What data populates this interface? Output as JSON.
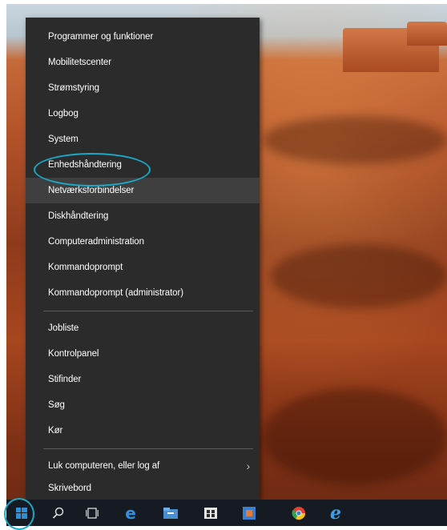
{
  "context_menu": {
    "items": [
      {
        "label": "Programmer og funktioner"
      },
      {
        "label": "Mobilitetscenter"
      },
      {
        "label": "Strømstyring"
      },
      {
        "label": "Logbog"
      },
      {
        "label": "System"
      },
      {
        "label": "Enhedshåndtering"
      },
      {
        "label": "Netværksforbindelser",
        "highlighted": true
      },
      {
        "label": "Diskhåndtering"
      },
      {
        "label": "Computeradministration"
      },
      {
        "label": "Kommandoprompt"
      },
      {
        "label": "Kommandoprompt (administrator)"
      },
      {
        "label": "Jobliste"
      },
      {
        "label": "Kontrolpanel"
      },
      {
        "label": "Stifinder"
      },
      {
        "label": "Søg"
      },
      {
        "label": "Kør"
      },
      {
        "label": "Luk computeren, eller log af",
        "submenu": true
      },
      {
        "label": "Skrivebord"
      }
    ]
  },
  "taskbar": {
    "icons": [
      "windows-start-icon",
      "search-icon",
      "task-view-icon",
      "edge-icon",
      "file-explorer-icon",
      "store-icon",
      "app-icon",
      "chrome-icon",
      "internet-explorer-icon"
    ]
  },
  "colors": {
    "menu_bg": "#2b2b2b",
    "highlight_bg": "#3f3f3f",
    "annotation_ring": "#19a9c4",
    "taskbar_bg": "#161a22"
  }
}
